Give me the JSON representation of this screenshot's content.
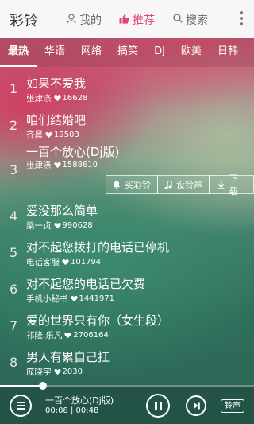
{
  "header": {
    "app_title": "彩铃",
    "nav": [
      {
        "label": "我的",
        "icon": "person-icon"
      },
      {
        "label": "推荐",
        "icon": "thumb-up-icon"
      },
      {
        "label": "搜索",
        "icon": "search-icon"
      }
    ],
    "active_nav": "推荐"
  },
  "tabs": [
    "最热",
    "华语",
    "网络",
    "搞笑",
    "DJ",
    "欧美",
    "日韩"
  ],
  "active_tab": "最热",
  "songs": [
    {
      "rank": "1",
      "title": "如果不爱我",
      "singer": "张津涤",
      "likes": "16628"
    },
    {
      "rank": "2",
      "title": "咱们结婚吧",
      "singer": "齐晨",
      "likes": "19503"
    },
    {
      "rank": "3",
      "title": "一百个放心(Dj版)",
      "singer": "张津涤",
      "likes": "1588610"
    },
    {
      "rank": "4",
      "title": "爱没那么简单",
      "singer": "梁一贞",
      "likes": "990628"
    },
    {
      "rank": "5",
      "title": "对不起您拨打的电话已停机",
      "singer": "电话客服",
      "likes": "101794"
    },
    {
      "rank": "6",
      "title": "对不起您的电话已欠费",
      "singer": "手机小秘书",
      "likes": "1441971"
    },
    {
      "rank": "7",
      "title": "爱的世界只有你（女生段）",
      "singer": "祁隆,乐凡",
      "likes": "2706164"
    },
    {
      "rank": "8",
      "title": "男人有累自己扛",
      "singer": "庞晓宇",
      "likes": "2030"
    }
  ],
  "row_actions": {
    "buy_ringtone": "买彩铃",
    "set_ringtone": "设铃声",
    "download": "下载"
  },
  "player": {
    "title": "一百个放心(Dj版)",
    "time": "00:08 | 00:48",
    "progress": 0.17,
    "ringtone_label": "铃声"
  },
  "colors": {
    "accent": "#e2456d",
    "header_bg": "#f7f7f7"
  }
}
